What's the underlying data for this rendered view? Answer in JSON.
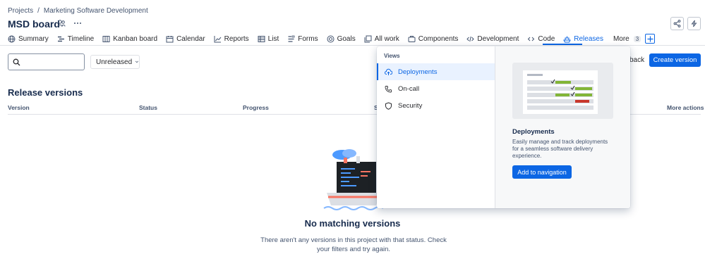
{
  "breadcrumb": {
    "projects": "Projects",
    "separator": "/",
    "project": "Marketing Software Development"
  },
  "board": {
    "title": "MSD board",
    "team_icon": "team-icon",
    "more_icon": "more-horizontal-icon"
  },
  "top_actions": {
    "share_icon": "share-icon",
    "automation_icon": "lightning-icon"
  },
  "tabs": [
    {
      "label": "Summary",
      "icon": "globe-icon"
    },
    {
      "label": "Timeline",
      "icon": "timeline-icon"
    },
    {
      "label": "Kanban board",
      "icon": "board-icon"
    },
    {
      "label": "Calendar",
      "icon": "calendar-icon"
    },
    {
      "label": "Reports",
      "icon": "chart-icon"
    },
    {
      "label": "List",
      "icon": "list-icon"
    },
    {
      "label": "Forms",
      "icon": "form-icon"
    },
    {
      "label": "Goals",
      "icon": "target-icon"
    },
    {
      "label": "All work",
      "icon": "stack-icon"
    },
    {
      "label": "Components",
      "icon": "component-icon"
    },
    {
      "label": "Development",
      "icon": "code-icon"
    },
    {
      "label": "Code",
      "icon": "branch-icon"
    },
    {
      "label": "Releases",
      "icon": "ship-icon",
      "active": true
    }
  ],
  "more_tab": {
    "label": "More",
    "count": "3"
  },
  "filters": {
    "search_placeholder": "",
    "status_value": "Unreleased"
  },
  "actions": {
    "feedback_label": "back",
    "create_label": "Create version"
  },
  "section_title": "Release versions",
  "table_headers": {
    "version": "Version",
    "status": "Status",
    "progress": "Progress",
    "start": "S",
    "more_actions": "More actions"
  },
  "empty_state": {
    "title": "No matching versions",
    "description": "There aren't any versions in this project with that status. Check your filters and try again."
  },
  "views_popup": {
    "header": "Views",
    "items": [
      {
        "label": "Deployments",
        "icon": "cloud-upload-icon",
        "active": true
      },
      {
        "label": "On-call",
        "icon": "phone-icon"
      },
      {
        "label": "Security",
        "icon": "shield-icon"
      }
    ],
    "preview": {
      "title": "Deployments",
      "description": "Easily manage and track deployments for a seamless software delivery experience.",
      "button_label": "Add to navigation"
    }
  },
  "colors": {
    "accent": "#0c66e4",
    "text": "#172b4d",
    "subtle": "#44546f"
  }
}
